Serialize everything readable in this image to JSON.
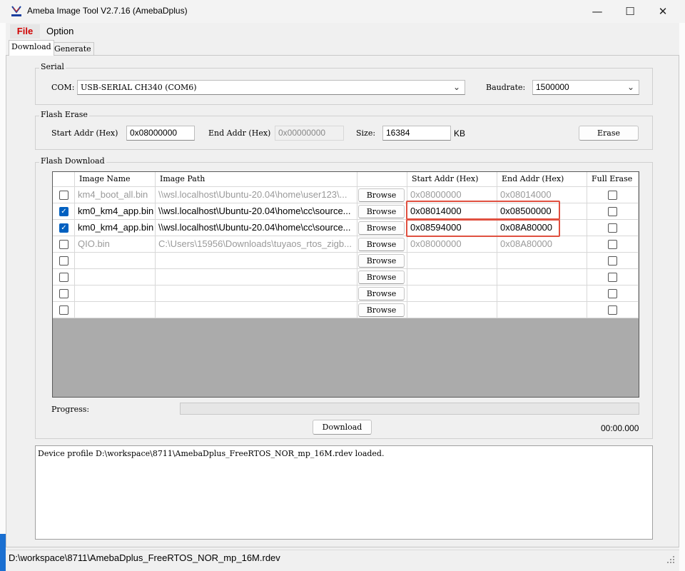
{
  "window": {
    "title": "Ameba Image Tool V2.7.16 (AmebaDplus)",
    "minimize": "—",
    "maximize": "☐",
    "close": "✕"
  },
  "menu": {
    "file": "File",
    "option": "Option"
  },
  "tabs": {
    "download": "Download",
    "generate": "Generate"
  },
  "serial": {
    "group": "Serial",
    "com_label": "COM:",
    "com_value": "USB-SERIAL CH340 (COM6)",
    "baud_label": "Baudrate:",
    "baud_value": "1500000"
  },
  "flash_erase": {
    "group": "Flash Erase",
    "start_label": "Start Addr (Hex)",
    "start_value": "0x08000000",
    "end_label": "End Addr (Hex)",
    "end_value": "0x00000000",
    "size_label": "Size:",
    "size_value": "16384",
    "size_unit": "KB",
    "erase_button": "Erase"
  },
  "flash_download": {
    "group": "Flash Download",
    "headers": {
      "image_name": "Image Name",
      "image_path": "Image Path",
      "start": "Start Addr (Hex)",
      "end": "End Addr (Hex)",
      "full_erase": "Full Erase"
    },
    "browse_label": "Browse",
    "rows": [
      {
        "checked": false,
        "name": "km4_boot_all.bin",
        "path": "\\\\wsl.localhost\\Ubuntu-20.04\\home\\user123\\...",
        "start": "0x08000000",
        "end": "0x08014000",
        "muted": true
      },
      {
        "checked": true,
        "name": "km0_km4_app.bin",
        "path": "\\\\wsl.localhost\\Ubuntu-20.04\\home\\cc\\source...",
        "start": "0x08014000",
        "end": "0x08500000",
        "muted": false
      },
      {
        "checked": true,
        "name": "km0_km4_app.bin",
        "path": "\\\\wsl.localhost\\Ubuntu-20.04\\home\\cc\\source...",
        "start": "0x08594000",
        "end": "0x08A80000",
        "muted": false
      },
      {
        "checked": false,
        "name": "QIO.bin",
        "path": "C:\\Users\\15956\\Downloads\\tuyaos_rtos_zigb...",
        "start": "0x08000000",
        "end": "0x08A80000",
        "muted": true
      },
      {
        "checked": false,
        "name": "",
        "path": "",
        "start": "",
        "end": "",
        "muted": true
      },
      {
        "checked": false,
        "name": "",
        "path": "",
        "start": "",
        "end": "",
        "muted": true
      },
      {
        "checked": false,
        "name": "",
        "path": "",
        "start": "",
        "end": "",
        "muted": true
      },
      {
        "checked": false,
        "name": "",
        "path": "",
        "start": "",
        "end": "",
        "muted": true
      }
    ]
  },
  "progress": {
    "label": "Progress:",
    "value": 0,
    "time": "00:00.000"
  },
  "download_button": "Download",
  "log": "Device profile D:\\workspace\\8711\\AmebaDplus_FreeRTOS_NOR_mp_16M.rdev loaded.",
  "status": "D:\\workspace\\8711\\AmebaDplus_FreeRTOS_NOR_mp_16M.rdev"
}
